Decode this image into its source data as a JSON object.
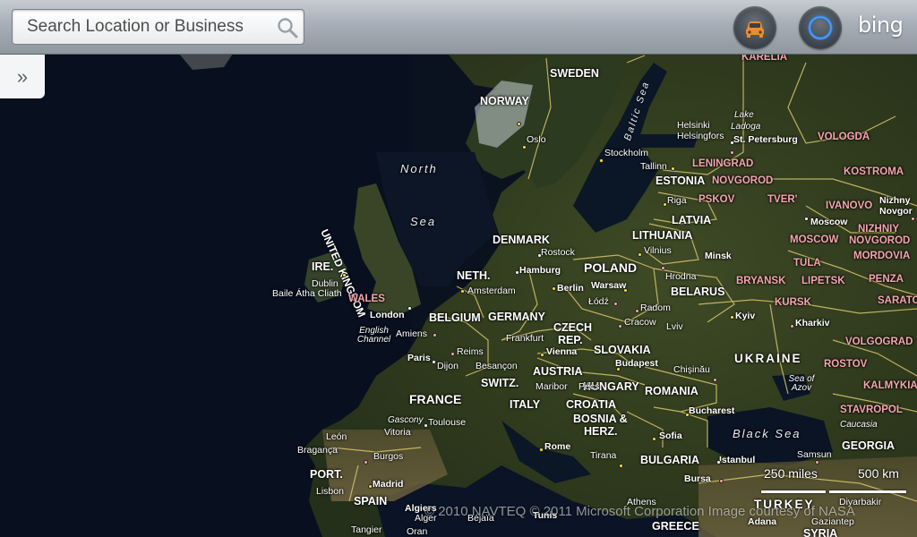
{
  "search": {
    "placeholder": "Search Location or Business",
    "value": ""
  },
  "toolbar": {
    "traffic_icon": "car-icon",
    "locate_icon": "locate-ring-icon",
    "brand": "bing"
  },
  "sidebar_toggle": {
    "icon": "double-chevron-right-icon",
    "glyph": "»"
  },
  "map": {
    "seas": [
      {
        "key": "north",
        "text": "North"
      },
      {
        "key": "sea",
        "text": "Sea"
      },
      {
        "key": "black",
        "text": "Black Sea"
      },
      {
        "key": "azov",
        "text": "Sea of Azov"
      },
      {
        "key": "channel",
        "text": "English Channel"
      }
    ],
    "baltic": "Baltic Sea",
    "uk": "UNITED KINGDOM",
    "countries": [
      {
        "key": "sweden",
        "text": "SWEDEN"
      },
      {
        "key": "norway",
        "text": "NORWAY"
      },
      {
        "key": "estonia",
        "text": "ESTONIA"
      },
      {
        "key": "latvia",
        "text": "LATVIA"
      },
      {
        "key": "lithuania",
        "text": "LITHUANIA"
      },
      {
        "key": "denmark",
        "text": "DENMARK"
      },
      {
        "key": "ire",
        "text": "IRE."
      },
      {
        "key": "neth",
        "text": "NETH."
      },
      {
        "key": "poland",
        "text": "POLAND"
      },
      {
        "key": "belarus",
        "text": "BELARUS"
      },
      {
        "key": "belgium",
        "text": "BELGIUM"
      },
      {
        "key": "germany",
        "text": "GERMANY"
      },
      {
        "key": "czech",
        "text": "CZECH"
      },
      {
        "key": "rep",
        "text": "REP."
      },
      {
        "key": "slovakia",
        "text": "SLOVAKIA"
      },
      {
        "key": "austria",
        "text": "AUSTRIA"
      },
      {
        "key": "france",
        "text": "FRANCE"
      },
      {
        "key": "switz",
        "text": "SWITZ."
      },
      {
        "key": "hungary",
        "text": "HUNGARY"
      },
      {
        "key": "romania",
        "text": "ROMANIA"
      },
      {
        "key": "croatia",
        "text": "CROATIA"
      },
      {
        "key": "italy",
        "text": "ITALY"
      },
      {
        "key": "bosnia",
        "text": "BOSNIA &"
      },
      {
        "key": "herz",
        "text": "HERZ."
      },
      {
        "key": "bulgaria",
        "text": "BULGARIA"
      },
      {
        "key": "port",
        "text": "PORT."
      },
      {
        "key": "spain",
        "text": "SPAIN"
      },
      {
        "key": "greece",
        "text": "GREECE"
      },
      {
        "key": "georgia",
        "text": "GEORGIA"
      },
      {
        "key": "ukraine",
        "text": "UKRAINE"
      },
      {
        "key": "turkey",
        "text": "TURKEY"
      },
      {
        "key": "syria",
        "text": "SYRIA"
      }
    ],
    "regions": [
      {
        "key": "karelia",
        "text": "KARELIA"
      },
      {
        "key": "vologda",
        "text": "VOLOGDA"
      },
      {
        "key": "leningrad",
        "text": "LENINGRAD"
      },
      {
        "key": "kostroma",
        "text": "KOSTROMA"
      },
      {
        "key": "novgorod",
        "text": "NOVGOROD"
      },
      {
        "key": "pskov",
        "text": "PSKOV"
      },
      {
        "key": "tver",
        "text": "TVER'"
      },
      {
        "key": "ivanovo",
        "text": "IVANOVO"
      },
      {
        "key": "nizhniy",
        "text": "NIZHNIY"
      },
      {
        "key": "moscow_r",
        "text": "MOSCOW"
      },
      {
        "key": "novgorod2",
        "text": "NOVGOROD"
      },
      {
        "key": "mordovia",
        "text": "MORDOVIA"
      },
      {
        "key": "tula",
        "text": "TULA"
      },
      {
        "key": "bryansk",
        "text": "BRYANSK"
      },
      {
        "key": "lipetsk",
        "text": "LIPETSK"
      },
      {
        "key": "penza",
        "text": "PENZA"
      },
      {
        "key": "kursk",
        "text": "KURSK"
      },
      {
        "key": "sarat",
        "text": "SARATO"
      },
      {
        "key": "volgograd",
        "text": "VOLGOGRAD"
      },
      {
        "key": "rostov",
        "text": "ROSTOV"
      },
      {
        "key": "kalmykia",
        "text": "KALMYKIA"
      },
      {
        "key": "stavropol",
        "text": "STAVROPOL"
      },
      {
        "key": "wales",
        "text": "WALES"
      }
    ],
    "cities": [
      {
        "key": "oslo",
        "text": "Oslo"
      },
      {
        "key": "stockholm",
        "text": "Stockholm"
      },
      {
        "key": "helsinki",
        "text": "Helsinki"
      },
      {
        "key": "helsingfors",
        "text": "Helsingfors"
      },
      {
        "key": "tallinn",
        "text": "Tallinn"
      },
      {
        "key": "lake",
        "text": "Lake"
      },
      {
        "key": "ladoga",
        "text": "Ladoga"
      },
      {
        "key": "stpete",
        "text": "St. Petersburg"
      },
      {
        "key": "riga",
        "text": "Riga"
      },
      {
        "key": "moscow",
        "text": "Moscow"
      },
      {
        "key": "nizhny",
        "text": "Nizhny"
      },
      {
        "key": "novgor",
        "text": "Novgor"
      },
      {
        "key": "vilnius",
        "text": "Vilnius"
      },
      {
        "key": "minsk",
        "text": "Minsk"
      },
      {
        "key": "rostock",
        "text": "Rostock"
      },
      {
        "key": "hamburg",
        "text": "Hamburg"
      },
      {
        "key": "dublin",
        "text": "Dublin"
      },
      {
        "key": "baile",
        "text": "Baile Átha Cliath"
      },
      {
        "key": "amsterdam",
        "text": "Amsterdam"
      },
      {
        "key": "berlin",
        "text": "Berlin"
      },
      {
        "key": "warsaw",
        "text": "Warsaw"
      },
      {
        "key": "hrodna",
        "text": "Hrodna"
      },
      {
        "key": "lodz",
        "text": "Łódź"
      },
      {
        "key": "radom",
        "text": "Radom"
      },
      {
        "key": "london",
        "text": "London"
      },
      {
        "key": "kyiv",
        "text": "Kyiv"
      },
      {
        "key": "kharkiv",
        "text": "Kharkiv"
      },
      {
        "key": "cracow",
        "text": "Cracow"
      },
      {
        "key": "lviv",
        "text": "Lviv"
      },
      {
        "key": "amiens",
        "text": "Amiens"
      },
      {
        "key": "frankfurt",
        "text": "Frankfurt"
      },
      {
        "key": "paris",
        "text": "Paris"
      },
      {
        "key": "reims",
        "text": "Reims"
      },
      {
        "key": "vienna",
        "text": "Vienna"
      },
      {
        "key": "budapest",
        "text": "Budapest"
      },
      {
        "key": "chisinau",
        "text": "Chişinău"
      },
      {
        "key": "dijon",
        "text": "Dijon"
      },
      {
        "key": "besancon",
        "text": "Besançon"
      },
      {
        "key": "maribor",
        "text": "Maribor"
      },
      {
        "key": "pecs",
        "text": "Pécs"
      },
      {
        "key": "bucharest",
        "text": "Bucharest"
      },
      {
        "key": "gascony",
        "text": "Gascony"
      },
      {
        "key": "toulouse",
        "text": "Toulouse"
      },
      {
        "key": "leon",
        "text": "León"
      },
      {
        "key": "vitoria",
        "text": "Vitoria"
      },
      {
        "key": "sofia",
        "text": "Sofia"
      },
      {
        "key": "braganca",
        "text": "Bragança"
      },
      {
        "key": "burgos",
        "text": "Burgos"
      },
      {
        "key": "rome",
        "text": "Rome"
      },
      {
        "key": "tirana",
        "text": "Tirana"
      },
      {
        "key": "istanbul",
        "text": "Istanbul"
      },
      {
        "key": "samsun",
        "text": "Samsun"
      },
      {
        "key": "madrid",
        "text": "Madrid"
      },
      {
        "key": "bursa",
        "text": "Bursa"
      },
      {
        "key": "lisbon",
        "text": "Lisbon"
      },
      {
        "key": "diyarbakir",
        "text": "Diyarbakir"
      },
      {
        "key": "algiers",
        "text": "Algiers"
      },
      {
        "key": "alger",
        "text": "Alger"
      },
      {
        "key": "bejaia",
        "text": "Béjaïa"
      },
      {
        "key": "tunis",
        "text": "Tunis"
      },
      {
        "key": "athens",
        "text": "Athens"
      },
      {
        "key": "adana",
        "text": "Adana"
      },
      {
        "key": "gaziantep",
        "text": "Gaziantep"
      },
      {
        "key": "tangier",
        "text": "Tangier"
      },
      {
        "key": "oran",
        "text": "Oran"
      },
      {
        "key": "caucasia",
        "text": "Caucasia"
      }
    ]
  },
  "scale": {
    "miles": "250 miles",
    "km": "500 km"
  },
  "copyright": "© 2010 NAVTEQ  © 2011 Microsoft Corporation  Image courtesy of NASA"
}
